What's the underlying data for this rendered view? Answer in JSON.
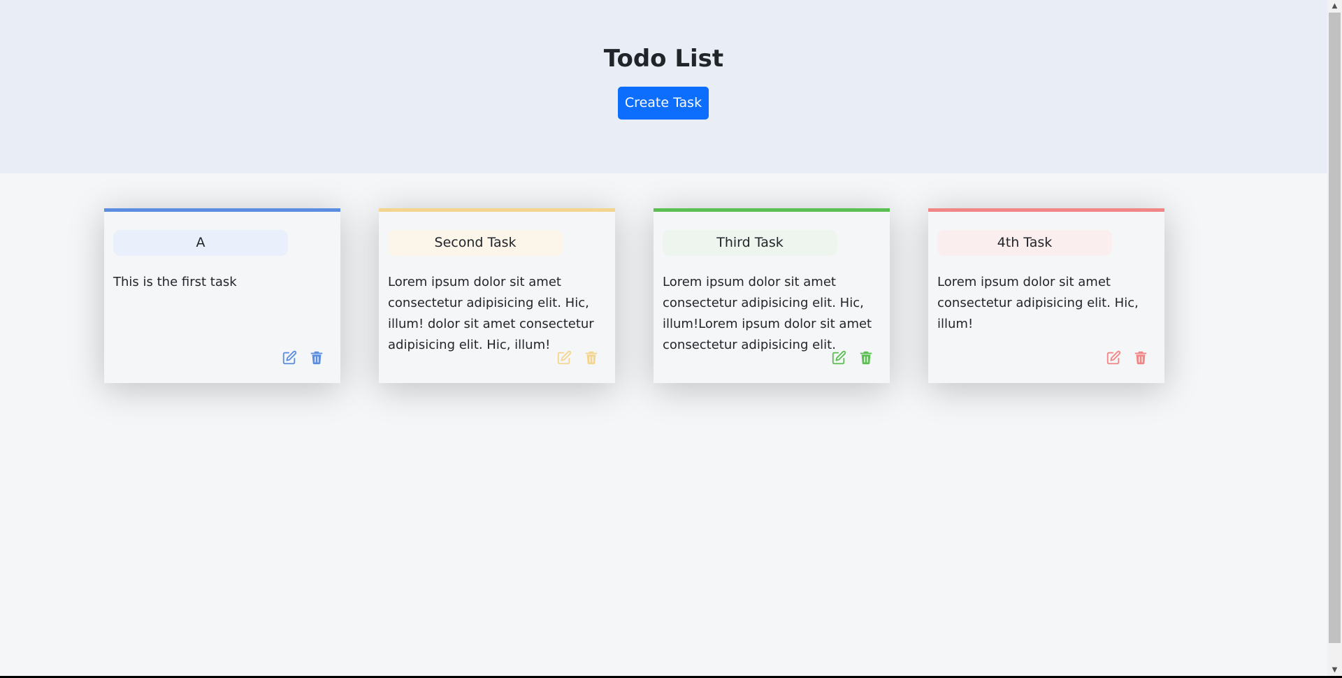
{
  "header": {
    "title": "Todo List",
    "create_button_label": "Create Task"
  },
  "cards": [
    {
      "title": "A",
      "description": "This is the first task",
      "accent_color": "#5b8ee0",
      "pill_color": "#e9f0fb",
      "edit_icon": "edit-icon",
      "delete_icon": "trash-icon"
    },
    {
      "title": "Second Task",
      "description": "Lorem ipsum dolor sit amet consectetur adipisicing elit. Hic, illum! dolor sit amet consectetur adipisicing elit. Hic, illum!",
      "accent_color": "#f4d58f",
      "pill_color": "#fbf5ea",
      "edit_icon": "edit-icon",
      "delete_icon": "trash-icon"
    },
    {
      "title": "Third Task",
      "description": "Lorem ipsum dolor sit amet consectetur adipisicing elit. Hic, illum!Lorem ipsum dolor sit amet consectetur adipisicing elit.",
      "accent_color": "#5cbf52",
      "pill_color": "#eef4ee",
      "edit_icon": "edit-icon",
      "delete_icon": "trash-icon"
    },
    {
      "title": "4th Task",
      "description": "Lorem ipsum dolor sit amet consectetur adipisicing elit. Hic, illum!",
      "accent_color": "#f28585",
      "pill_color": "#fbeeee",
      "edit_icon": "edit-icon",
      "delete_icon": "trash-icon"
    }
  ],
  "colors": {
    "header_bg": "#e9edf5",
    "page_bg": "#f5f6f8",
    "primary_button": "#0d6efd"
  }
}
